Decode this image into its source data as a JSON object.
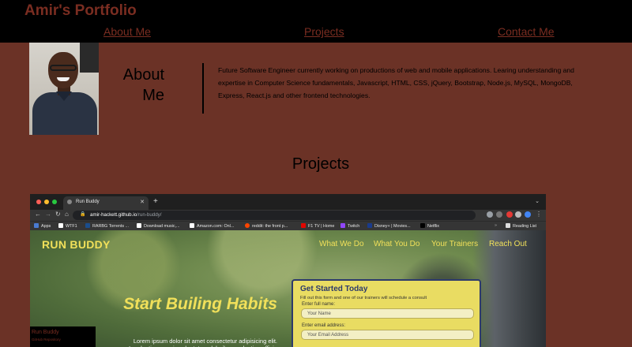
{
  "header": {
    "title": "Amir's Portfolio",
    "nav": [
      "About Me",
      "Projects",
      "Contact Me"
    ]
  },
  "about": {
    "heading": "About Me",
    "text": "Future Software Engineer currently working on productions of web and mobile applications. Learing understanding and expertise in Computer Science fundamentals, Javascript, HTML, CSS, jQuery, Bootstrap, Node.js, MySQL, MongoDB, Express, React.js and other frontend technologies."
  },
  "projects": {
    "heading": "Projects"
  },
  "screenshot": {
    "tab_title": "Run Buddy",
    "url_host": "amir-hackett.github.io",
    "url_path": "/run-buddy/",
    "bookmarks": [
      "Apps",
      "WTF1",
      "RARBG Torrents ...",
      "Download music,...",
      "Amazon.com: Onl...",
      "reddit: the front p...",
      "F1 TV | Home",
      "Twitch",
      "Disney+ | Movies...",
      "Netflix"
    ],
    "reading_list": "Reading List",
    "site": {
      "logo": "RUN BUDDY",
      "nav": [
        "What We Do",
        "What You Do",
        "Your Trainers",
        "Reach Out"
      ],
      "hero_title": "Start Builing Habits",
      "hero_text": "Lorem ipsum dolor sit amet consectetur adipisicing elit. Laudantium omnis voluptates, doloribus molestiae officia",
      "form": {
        "title": "Get Started Today",
        "subtitle": "Fill out this form and one of our trainers will schedule a consult",
        "name_label": "Enter full name:",
        "name_placeholder": "Your Name",
        "email_label": "Enter email address:",
        "email_placeholder": "Your Email Address"
      }
    },
    "thumb_title": "Run Buddy",
    "thumb_link": "GitHub Repository"
  },
  "colors": {
    "background": "#6b3226",
    "header_bg": "#000000",
    "accent_text": "#7a2d21",
    "runbuddy_yellow": "#f1e05a",
    "runbuddy_navy": "#2d3a6b"
  }
}
